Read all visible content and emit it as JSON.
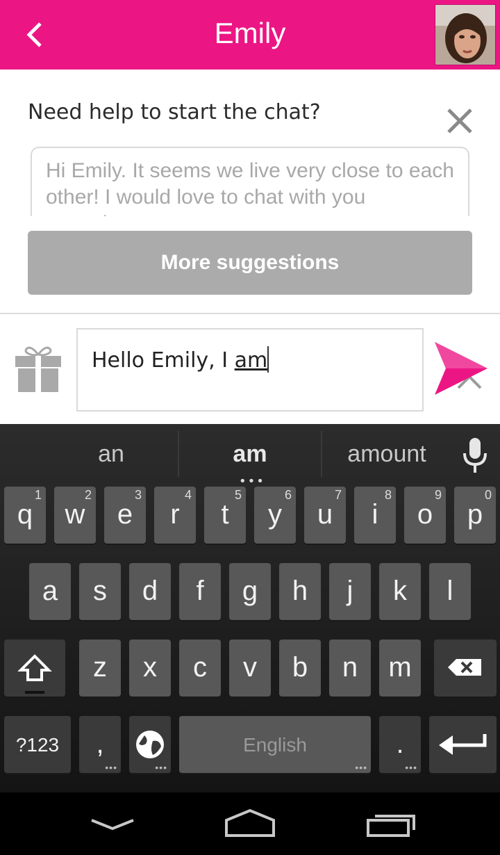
{
  "header": {
    "title": "Emily",
    "back_icon": "chevron-left-icon",
    "bg_color": "#ec1584"
  },
  "suggestion": {
    "title": "Need help to start the chat?",
    "text": "Hi Emily. It seems we live very close to each other! I would love to chat with you sometime.",
    "more_label": "More suggestions"
  },
  "composer": {
    "text_plain": "Hello Emily, I ",
    "text_underlined": "am",
    "gift_icon": "gift-icon",
    "send_icon": "send-icon"
  },
  "keyboard": {
    "suggestions": [
      "an",
      "am",
      "amount"
    ],
    "row1": [
      {
        "ch": "q",
        "num": "1"
      },
      {
        "ch": "w",
        "num": "2"
      },
      {
        "ch": "e",
        "num": "3"
      },
      {
        "ch": "r",
        "num": "4"
      },
      {
        "ch": "t",
        "num": "5"
      },
      {
        "ch": "y",
        "num": "6"
      },
      {
        "ch": "u",
        "num": "7"
      },
      {
        "ch": "i",
        "num": "8"
      },
      {
        "ch": "o",
        "num": "9"
      },
      {
        "ch": "p",
        "num": "0"
      }
    ],
    "row2": [
      "a",
      "s",
      "d",
      "f",
      "g",
      "h",
      "j",
      "k",
      "l"
    ],
    "row3": [
      "z",
      "x",
      "c",
      "v",
      "b",
      "n",
      "m"
    ],
    "symbols_label": "?123",
    "comma_label": ",",
    "space_label": "English",
    "period_label": "."
  }
}
